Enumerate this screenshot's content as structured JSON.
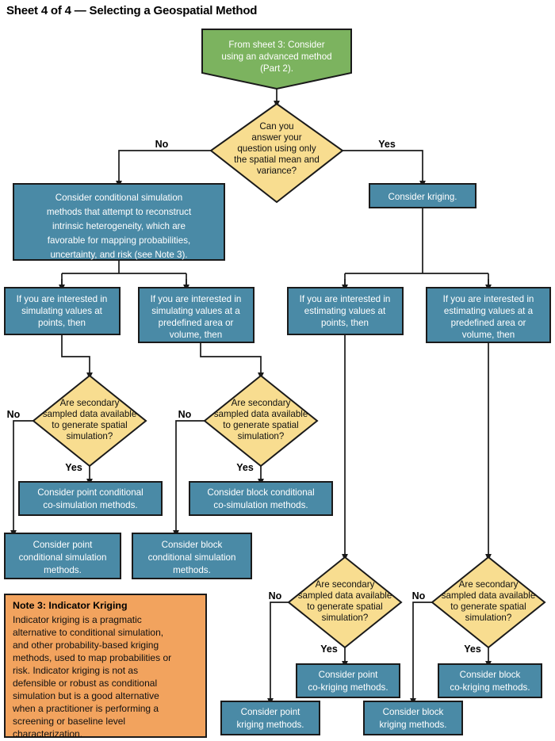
{
  "title": "Sheet 4 of 4 — Selecting a Geospatial Method",
  "nodes": {
    "start": {
      "label_lines": [
        "From sheet 3: Consider",
        "using an advanced method",
        "(Part 2)."
      ],
      "shape": "pentagon-down",
      "color": "#7cb35f"
    },
    "d_main": {
      "label_lines": [
        "Can you",
        "answer your",
        "question using only",
        "the spatial mean and",
        "variance?"
      ],
      "shape": "diamond",
      "color": "#f8dd90"
    },
    "cond_sim": {
      "label_lines": [
        "Consider conditional simulation",
        "methods that attempt to reconstruct",
        "intrinsic heterogeneity, which are",
        "favorable for mapping probabilities,",
        "uncertainty, and risk (see Note 3)."
      ],
      "shape": "rect",
      "color": "#4a8aa6"
    },
    "kriging": {
      "label_lines": [
        "Consider kriging."
      ],
      "shape": "rect",
      "color": "#4a8aa6"
    },
    "sim_points": {
      "label_lines": [
        "If you are interested in",
        "simulating values at",
        "points, then"
      ],
      "shape": "rect",
      "color": "#4a8aa6"
    },
    "sim_block": {
      "label_lines": [
        "If you are interested in",
        "simulating values at a",
        "predefined area or",
        "volume, then"
      ],
      "shape": "rect",
      "color": "#4a8aa6"
    },
    "est_points": {
      "label_lines": [
        "If you are interested in",
        "estimating values at",
        "points, then"
      ],
      "shape": "rect",
      "color": "#4a8aa6"
    },
    "est_block": {
      "label_lines": [
        "If you are interested in",
        "estimating values at a",
        "predefined area or",
        "volume, then"
      ],
      "shape": "rect",
      "color": "#4a8aa6"
    },
    "d_sec1": {
      "label_lines": [
        "Are secondary",
        "sampled data available",
        "to generate spatial",
        "simulation?"
      ],
      "shape": "diamond",
      "color": "#f8dd90"
    },
    "d_sec2": {
      "label_lines": [
        "Are secondary",
        "sampled data available",
        "to generate spatial",
        "simulation?"
      ],
      "shape": "diamond",
      "color": "#f8dd90"
    },
    "d_sec3": {
      "label_lines": [
        "Are secondary",
        "sampled data available",
        "to generate spatial",
        "simulation?"
      ],
      "shape": "diamond",
      "color": "#f8dd90"
    },
    "d_sec4": {
      "label_lines": [
        "Are secondary",
        "sampled data available",
        "to generate spatial",
        "simulation?"
      ],
      "shape": "diamond",
      "color": "#f8dd90"
    },
    "point_cosim": {
      "label_lines": [
        "Consider point conditional",
        "co-simulation methods."
      ],
      "shape": "rect",
      "color": "#4a8aa6"
    },
    "block_cosim": {
      "label_lines": [
        "Consider block conditional",
        "co-simulation methods."
      ],
      "shape": "rect",
      "color": "#4a8aa6"
    },
    "point_sim": {
      "label_lines": [
        "Consider point",
        "conditional simulation",
        "methods."
      ],
      "shape": "rect",
      "color": "#4a8aa6"
    },
    "block_sim": {
      "label_lines": [
        "Consider block",
        "conditional simulation",
        "methods."
      ],
      "shape": "rect",
      "color": "#4a8aa6"
    },
    "point_cokrig": {
      "label_lines": [
        "Consider point",
        "co-kriging methods."
      ],
      "shape": "rect",
      "color": "#4a8aa6"
    },
    "block_cokrig": {
      "label_lines": [
        "Consider block",
        "co-kriging methods."
      ],
      "shape": "rect",
      "color": "#4a8aa6"
    },
    "point_krig": {
      "label_lines": [
        "Consider point",
        "kriging methods."
      ],
      "shape": "rect",
      "color": "#4a8aa6"
    },
    "block_krig": {
      "label_lines": [
        "Consider block",
        "kriging methods."
      ],
      "shape": "rect",
      "color": "#4a8aa6"
    }
  },
  "edge_labels": {
    "main_no": "No",
    "main_yes": "Yes",
    "sec1_no": "No",
    "sec1_yes": "Yes",
    "sec2_no": "No",
    "sec2_yes": "Yes",
    "sec3_no": "No",
    "sec3_yes": "Yes",
    "sec4_no": "No",
    "sec4_yes": "Yes"
  },
  "note": {
    "heading": "Note 3: Indicator Kriging",
    "body_lines": [
      "Indicator kriging is a pragmatic",
      "alternative to conditional simulation,",
      "and other probability-based kriging",
      "methods, used to map probabilities or",
      "risk. Indicator kriging is not as",
      "defensible or robust as conditional",
      "simulation but is a good alternative",
      "when a practitioner is performing a",
      "screening or baseline level",
      "characterization."
    ],
    "color": "#f2a35e"
  },
  "colors": {
    "blue": "#4a8aa6",
    "yellow": "#f8dd90",
    "green": "#7cb35f",
    "orange": "#f2a35e",
    "stroke": "#1a1a1a",
    "text_light": "#ffffff",
    "text_dark": "#111111"
  }
}
